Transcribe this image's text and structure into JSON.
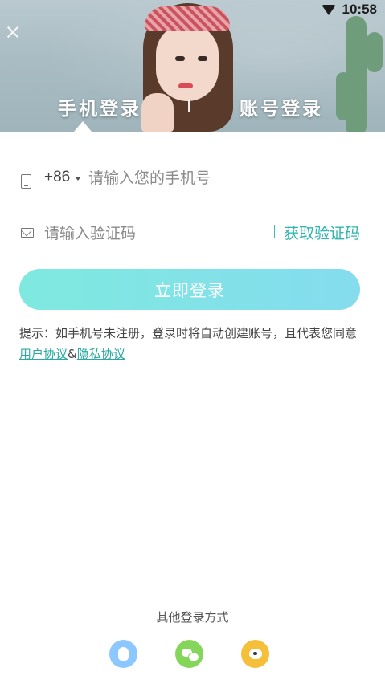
{
  "status_bar": {
    "time": "10:58",
    "wifi_icon": "wifi-icon"
  },
  "header": {
    "close_icon": "close-icon",
    "tabs": [
      {
        "label": "手机登录",
        "active": true
      },
      {
        "label": "账号登录",
        "active": false
      }
    ]
  },
  "form": {
    "country_code": "+86",
    "phone_placeholder": "请输入您的手机号",
    "code_placeholder": "请输入验证码",
    "get_code_label": "获取验证码",
    "submit_label": "立即登录"
  },
  "hint": {
    "text": "提示：如手机号未注册，登录时将自动创建账号，且代表您同意",
    "user_agreement": "用户协议",
    "separator": "&",
    "privacy_policy": "隐私协议"
  },
  "other_login": {
    "title": "其他登录方式",
    "providers": [
      "qq-icon",
      "wechat-icon",
      "weibo-icon"
    ]
  },
  "colors": {
    "accent": "#2fb5ad",
    "button_start": "#7fe9df",
    "button_end": "#84dcee"
  }
}
